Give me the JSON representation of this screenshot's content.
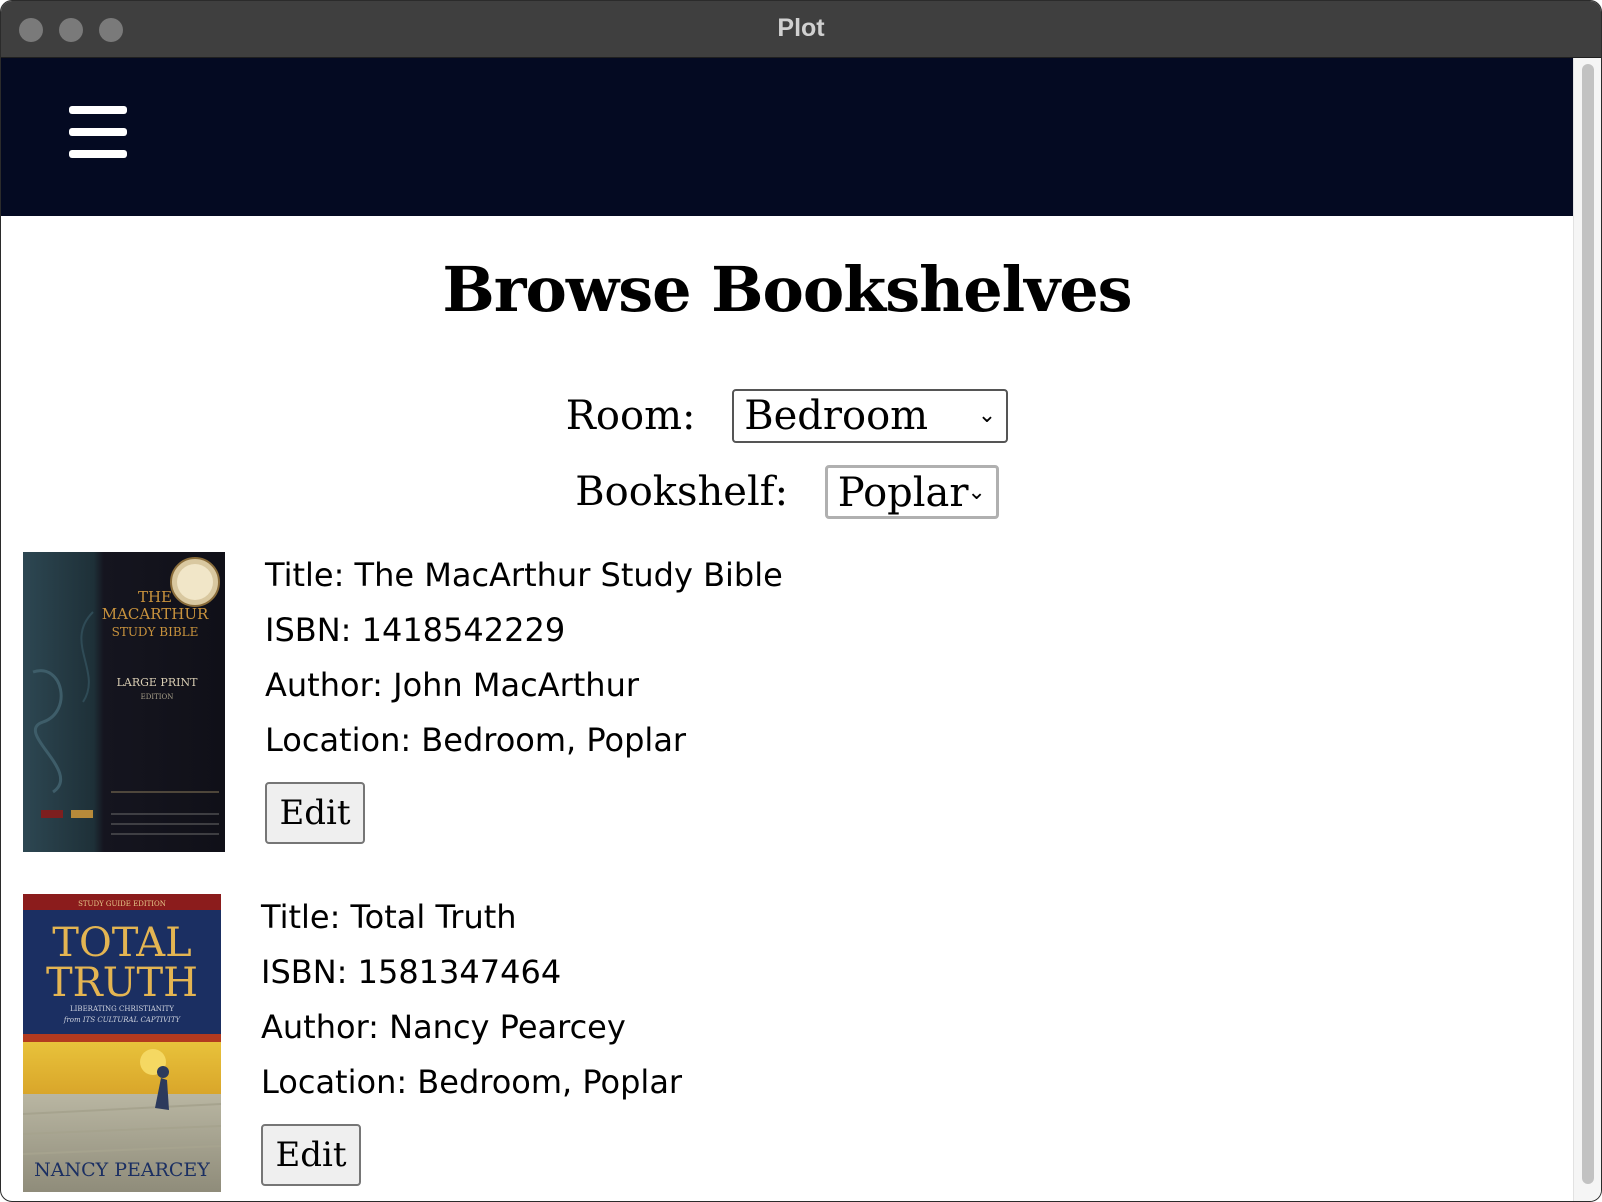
{
  "window": {
    "title": "Plot"
  },
  "header": {
    "menu_icon": "hamburger-menu-icon"
  },
  "page": {
    "title": "Browse Bookshelves"
  },
  "filters": {
    "room": {
      "label": "Room:",
      "selected": "Bedroom"
    },
    "bookshelf": {
      "label": "Bookshelf:",
      "selected": "Poplar"
    }
  },
  "books": [
    {
      "title": "Title: The MacArthur Study Bible",
      "isbn": "ISBN: 1418542229",
      "author": "Author: John MacArthur",
      "location": "Location: Bedroom, Poplar",
      "edit_label": "Edit",
      "cover": {
        "line1": "THE",
        "line2": "MACARTHUR",
        "line3": "STUDY BIBLE",
        "line4": "LARGE PRINT",
        "line5": "EDITION"
      }
    },
    {
      "title": "Title: Total Truth",
      "isbn": "ISBN: 1581347464",
      "author": "Author: Nancy Pearcey",
      "location": "Location: Bedroom, Poplar",
      "edit_label": "Edit",
      "cover": {
        "top": "STUDY GUIDE EDITION",
        "line1": "TOTAL",
        "line2": "TRUTH",
        "sub1": "LIBERATING CHRISTIANITY",
        "sub2": "from ITS CULTURAL CAPTIVITY",
        "author": "NANCY PEARCEY"
      }
    }
  ],
  "colors": {
    "titlebar": "#3f3f3f",
    "appbar": "#040a22",
    "button_bg": "#efefef"
  }
}
